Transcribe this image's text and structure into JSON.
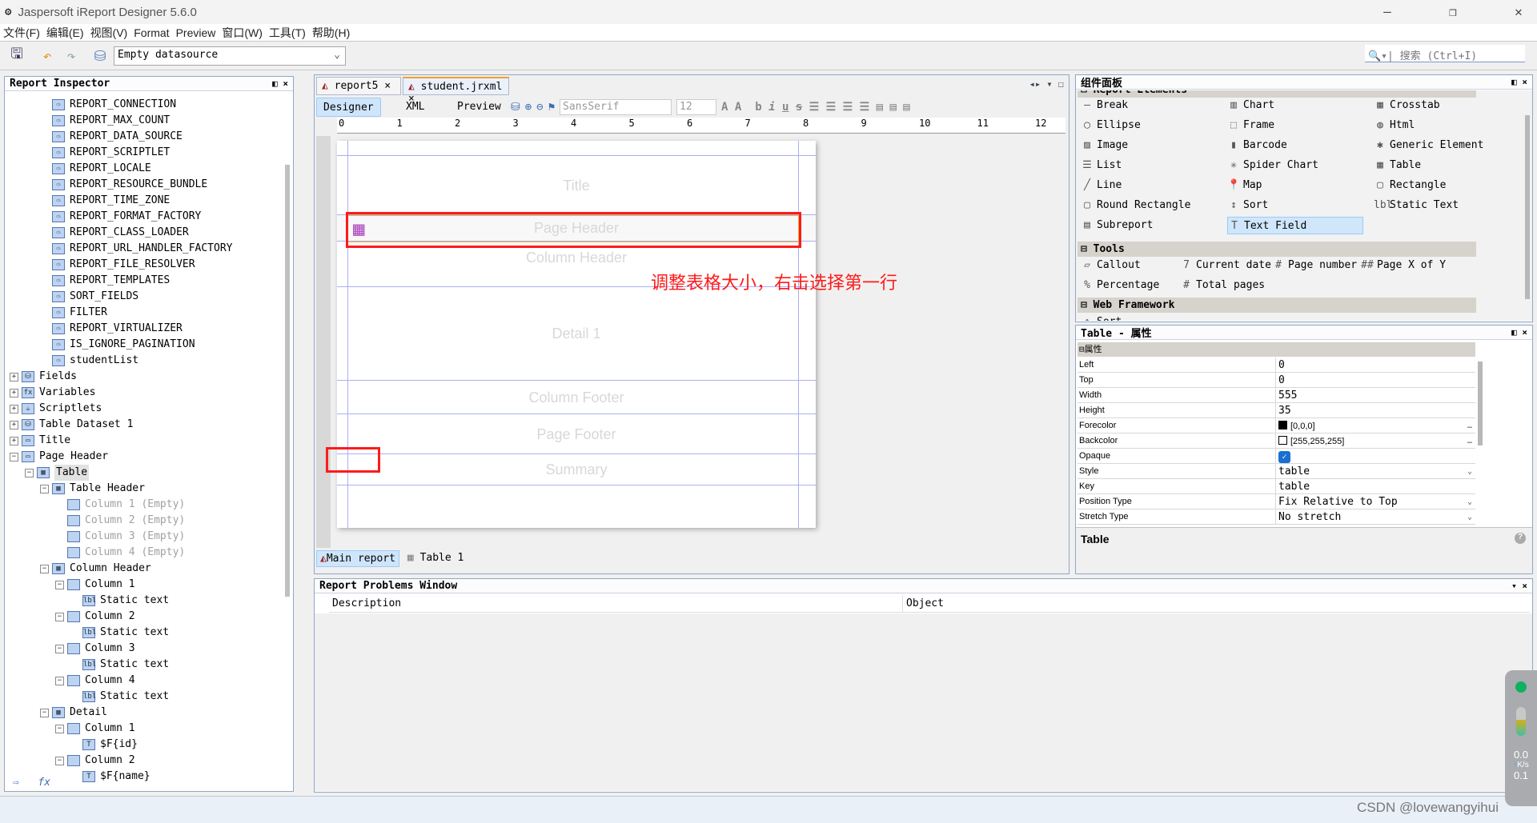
{
  "window": {
    "title": "Jaspersoft iReport Designer 5.6.0",
    "minimize": "—",
    "restore": "❐",
    "close": "✕"
  },
  "menu": [
    "文件(F)",
    "编辑(E)",
    "视图(V)",
    "Format",
    "Preview",
    "窗口(W)",
    "工具(T)",
    "帮助(H)"
  ],
  "toolbar": {
    "datasource": "Empty datasource",
    "search_placeholder": "搜索 (Ctrl+I)"
  },
  "inspector": {
    "title": "Report Inspector",
    "items": [
      {
        "l": 2,
        "t": "REPORT_CONNECTION",
        "i": "param"
      },
      {
        "l": 2,
        "t": "REPORT_MAX_COUNT",
        "i": "param"
      },
      {
        "l": 2,
        "t": "REPORT_DATA_SOURCE",
        "i": "param"
      },
      {
        "l": 2,
        "t": "REPORT_SCRIPTLET",
        "i": "param"
      },
      {
        "l": 2,
        "t": "REPORT_LOCALE",
        "i": "param"
      },
      {
        "l": 2,
        "t": "REPORT_RESOURCE_BUNDLE",
        "i": "param"
      },
      {
        "l": 2,
        "t": "REPORT_TIME_ZONE",
        "i": "param"
      },
      {
        "l": 2,
        "t": "REPORT_FORMAT_FACTORY",
        "i": "param"
      },
      {
        "l": 2,
        "t": "REPORT_CLASS_LOADER",
        "i": "param"
      },
      {
        "l": 2,
        "t": "REPORT_URL_HANDLER_FACTORY",
        "i": "param"
      },
      {
        "l": 2,
        "t": "REPORT_FILE_RESOLVER",
        "i": "param"
      },
      {
        "l": 2,
        "t": "REPORT_TEMPLATES",
        "i": "param"
      },
      {
        "l": 2,
        "t": "SORT_FIELDS",
        "i": "param"
      },
      {
        "l": 2,
        "t": "FILTER",
        "i": "param"
      },
      {
        "l": 2,
        "t": "REPORT_VIRTUALIZER",
        "i": "param"
      },
      {
        "l": 2,
        "t": "IS_IGNORE_PAGINATION",
        "i": "param"
      },
      {
        "l": 2,
        "t": "studentList",
        "i": "param"
      },
      {
        "l": 0,
        "t": "Fields",
        "i": "db",
        "e": "+"
      },
      {
        "l": 0,
        "t": "Variables",
        "i": "fx",
        "e": "+"
      },
      {
        "l": 0,
        "t": "Scriptlets",
        "i": "cup",
        "e": "+"
      },
      {
        "l": 0,
        "t": "Table Dataset 1",
        "i": "db",
        "e": "+"
      },
      {
        "l": 0,
        "t": "Title",
        "i": "band",
        "e": "+"
      },
      {
        "l": 0,
        "t": "Page Header",
        "i": "band",
        "e": "−"
      },
      {
        "l": 1,
        "t": "Table",
        "i": "table",
        "e": "−",
        "sel": true
      },
      {
        "l": 2,
        "t": "Table Header",
        "i": "table",
        "e": "−"
      },
      {
        "l": 3,
        "t": "Column 1 (Empty)",
        "i": "col",
        "g": true
      },
      {
        "l": 3,
        "t": "Column 2 (Empty)",
        "i": "col",
        "g": true
      },
      {
        "l": 3,
        "t": "Column 3 (Empty)",
        "i": "col",
        "g": true
      },
      {
        "l": 3,
        "t": "Column 4 (Empty)",
        "i": "col",
        "g": true
      },
      {
        "l": 2,
        "t": "Column Header",
        "i": "table",
        "e": "−"
      },
      {
        "l": 3,
        "t": "Column 1",
        "i": "col",
        "e": "−"
      },
      {
        "l": 4,
        "t": "Static text",
        "i": "label"
      },
      {
        "l": 3,
        "t": "Column 2",
        "i": "col",
        "e": "−"
      },
      {
        "l": 4,
        "t": "Static text",
        "i": "label"
      },
      {
        "l": 3,
        "t": "Column 3",
        "i": "col",
        "e": "−"
      },
      {
        "l": 4,
        "t": "Static text",
        "i": "label"
      },
      {
        "l": 3,
        "t": "Column 4",
        "i": "col",
        "e": "−"
      },
      {
        "l": 4,
        "t": "Static text",
        "i": "label"
      },
      {
        "l": 2,
        "t": "Detail",
        "i": "table",
        "e": "−"
      },
      {
        "l": 3,
        "t": "Column 1",
        "i": "col",
        "e": "−"
      },
      {
        "l": 4,
        "t": "$F{id}",
        "i": "textfield"
      },
      {
        "l": 3,
        "t": "Column 2",
        "i": "col",
        "e": "−"
      },
      {
        "l": 4,
        "t": "$F{name}",
        "i": "textfield"
      }
    ]
  },
  "editor": {
    "tabs": [
      "report5",
      "student.jrxml"
    ],
    "modes": [
      "Designer",
      "XML",
      "Preview"
    ],
    "font": "SansSerif",
    "size": "12",
    "ruler": [
      "0",
      "1",
      "2",
      "3",
      "4",
      "5",
      "6",
      "7",
      "8",
      "9",
      "10",
      "11",
      "12"
    ],
    "bands": [
      "Title",
      "Page Header",
      "Column Header",
      "Detail 1",
      "Column Footer",
      "Page Footer",
      "Summary"
    ],
    "bottom_tabs": [
      "Main report",
      "Table 1"
    ],
    "annotation": "调整表格大小，右击选择第一行"
  },
  "palette": {
    "title": "组件面板",
    "sections": [
      "Report Elements",
      "Tools",
      "Web Framework"
    ],
    "elements": [
      "Break",
      "Chart",
      "Crosstab",
      "Ellipse",
      "Frame",
      "Html",
      "Image",
      "Barcode",
      "Generic Element",
      "List",
      "Spider Chart",
      "Table",
      "Line",
      "Map",
      "Rectangle",
      "Round Rectangle",
      "Sort",
      "Static Text",
      "Subreport",
      "Text Field"
    ],
    "tools": [
      "Callout",
      "Current date",
      "Page number",
      "Page X of Y",
      "Percentage",
      "Total pages"
    ],
    "web": [
      "Sort"
    ]
  },
  "properties": {
    "title": "Table - 属性",
    "section": "属性",
    "rows": [
      {
        "k": "Left",
        "v": "0"
      },
      {
        "k": "Top",
        "v": "0"
      },
      {
        "k": "Width",
        "v": "555"
      },
      {
        "k": "Height",
        "v": "35"
      },
      {
        "k": "Forecolor",
        "v": "[0,0,0]",
        "color": "#000000"
      },
      {
        "k": "Backcolor",
        "v": "[255,255,255]",
        "color": "#ffffff"
      },
      {
        "k": "Opaque",
        "v": "",
        "checked": true
      },
      {
        "k": "Style",
        "v": "table",
        "dd": true
      },
      {
        "k": "Key",
        "v": "table"
      },
      {
        "k": "Position Type",
        "v": "Fix Relative to Top",
        "dd": true
      },
      {
        "k": "Stretch Type",
        "v": "No stretch",
        "dd": true
      }
    ],
    "footer": "Table"
  },
  "problems": {
    "title": "Report Problems Window",
    "cols": [
      "Description",
      "Object"
    ]
  },
  "net": {
    "up": "0.0",
    "down": "0.1",
    "unit": "K/s"
  },
  "watermark": "CSDN @lovewangyihui",
  "colors": {
    "annotation": "#ff1a1a",
    "selection": "#f0b030",
    "accent": "#cfe5fb"
  }
}
